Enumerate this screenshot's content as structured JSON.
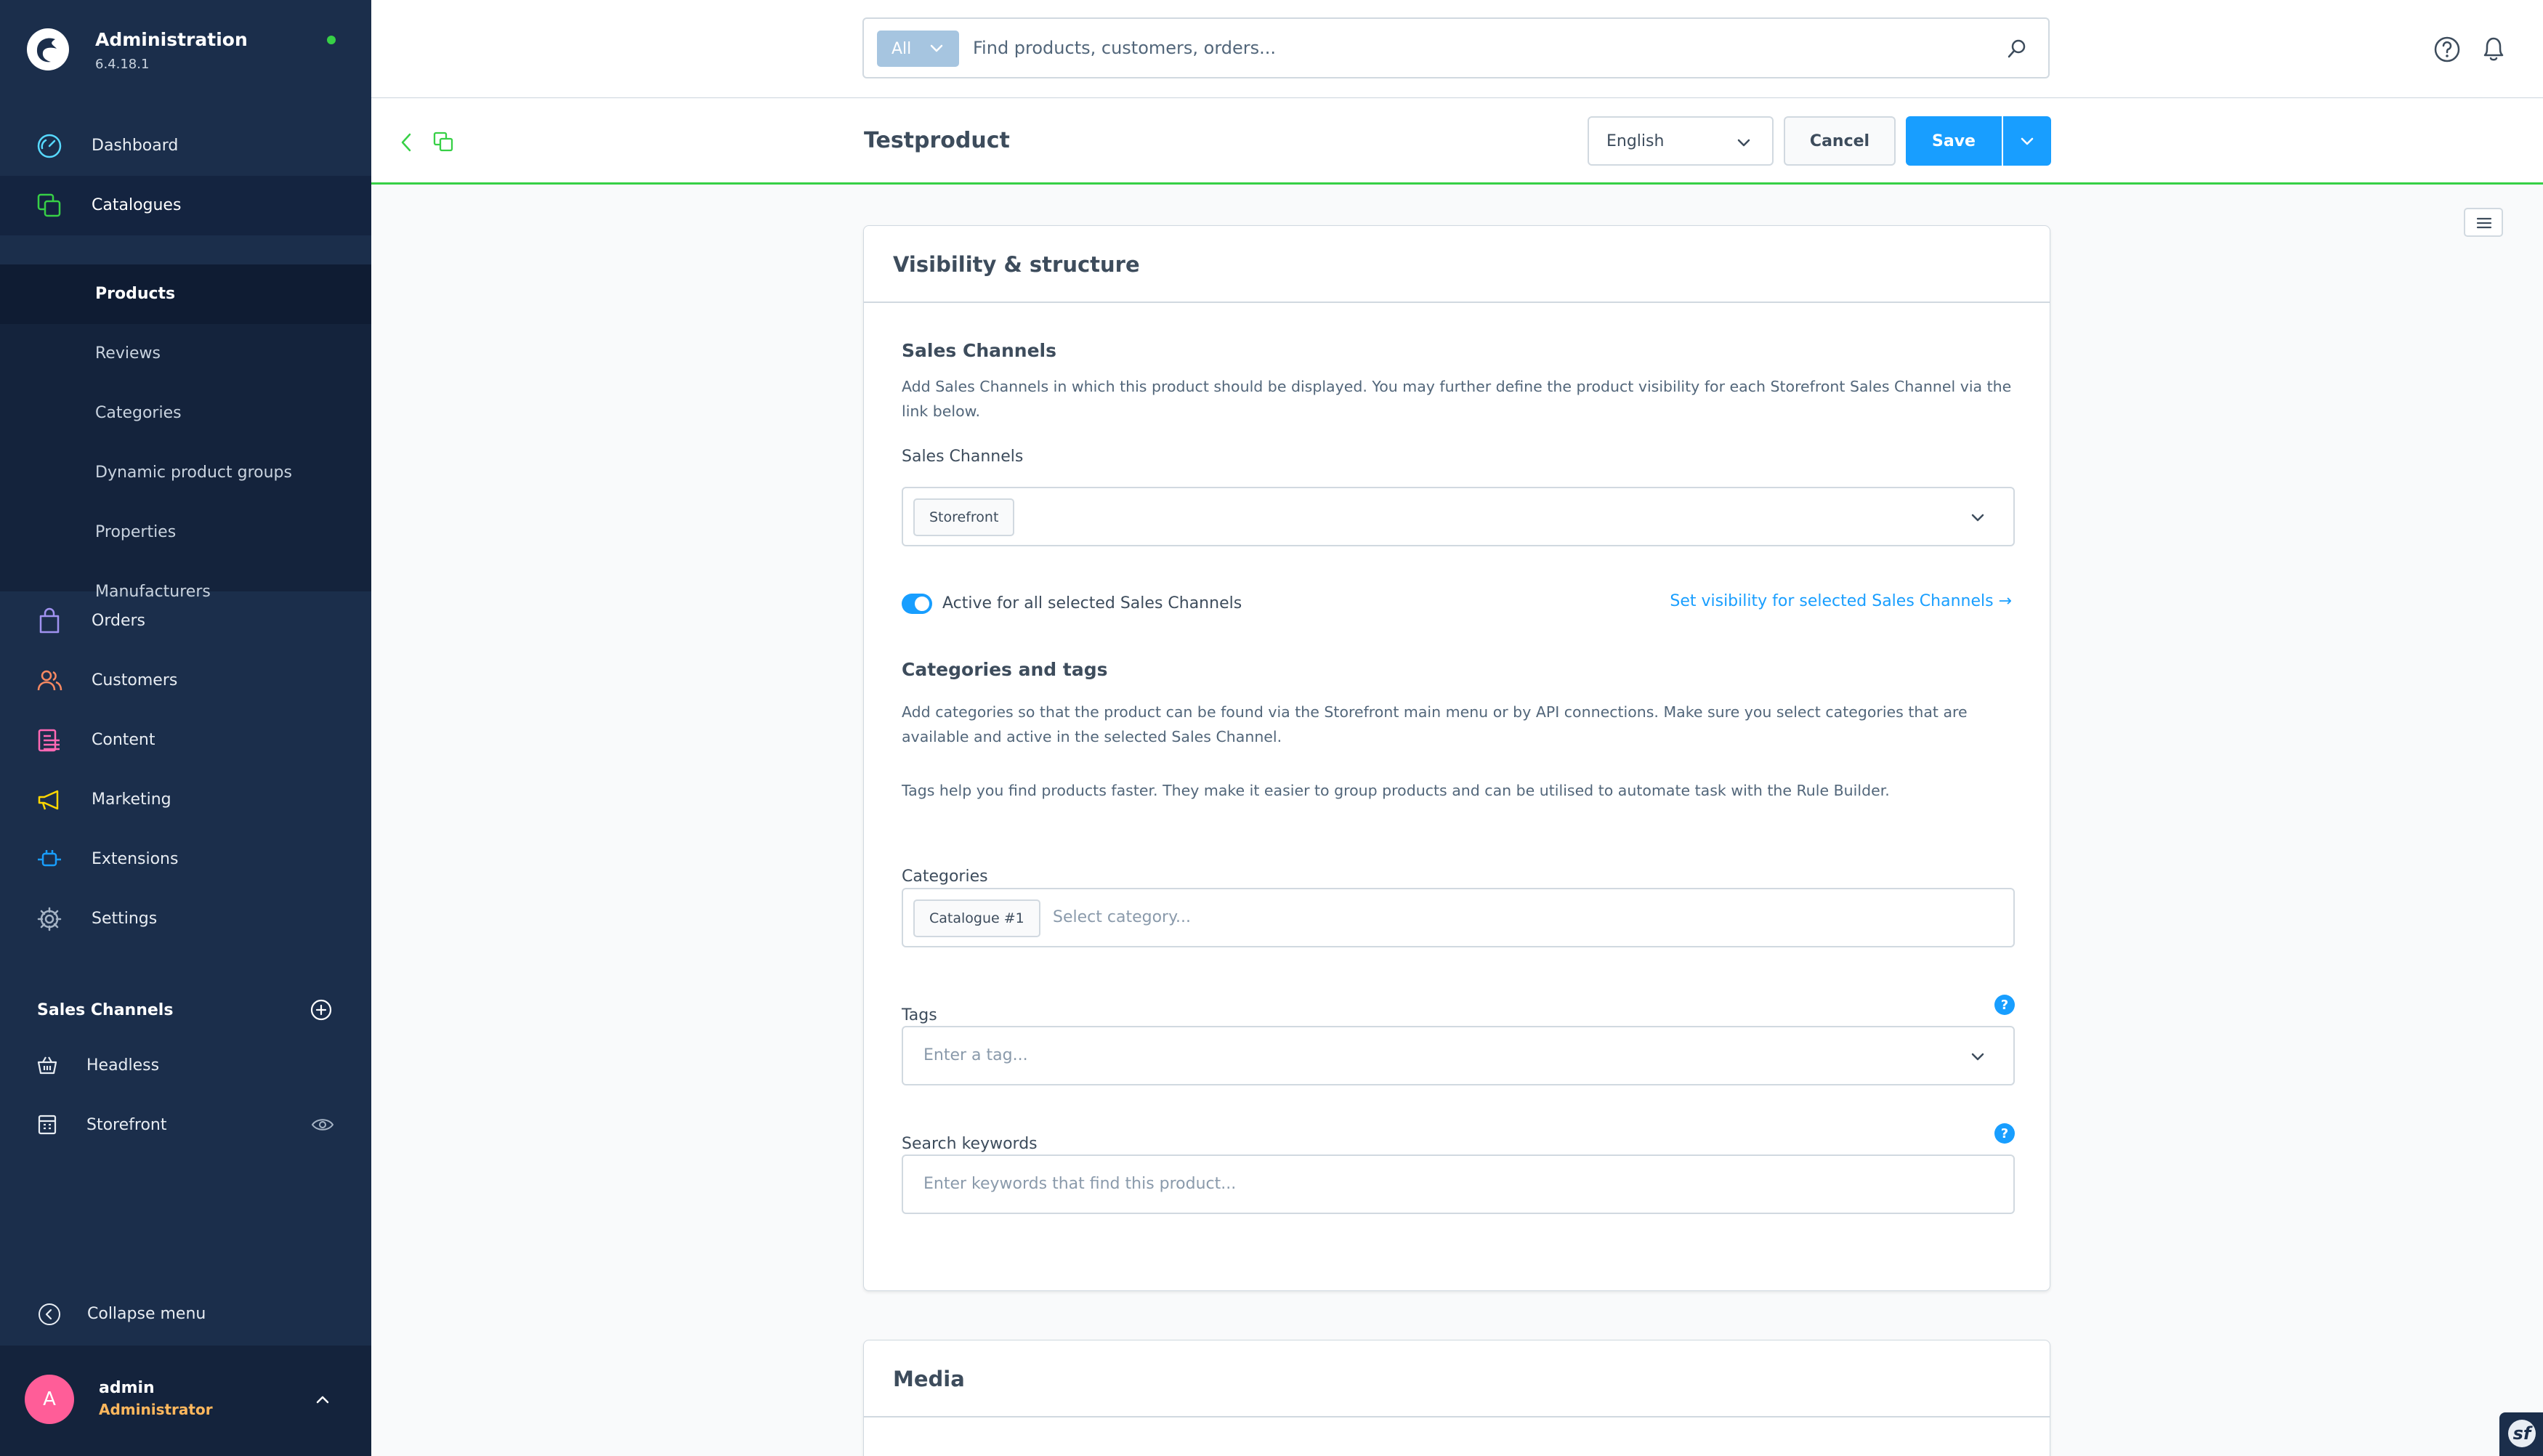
{
  "app": {
    "title": "Administration",
    "version": "6.4.18.1",
    "status_color": "#37d046"
  },
  "nav": {
    "dashboard": "Dashboard",
    "catalogues": "Catalogues",
    "catalogue_items": [
      "Products",
      "Reviews",
      "Categories",
      "Dynamic product groups",
      "Properties",
      "Manufacturers"
    ],
    "orders": "Orders",
    "customers": "Customers",
    "content": "Content",
    "marketing": "Marketing",
    "extensions": "Extensions",
    "settings": "Settings"
  },
  "sales_channels": {
    "header": "Sales Channels",
    "items": [
      "Headless",
      "Storefront"
    ]
  },
  "collapse_label": "Collapse menu",
  "user": {
    "initial": "A",
    "name": "admin",
    "role": "Administrator"
  },
  "search": {
    "type_label": "All",
    "placeholder": "Find products, customers, orders..."
  },
  "smartbar": {
    "title": "Testproduct",
    "language": "English",
    "cancel_label": "Cancel",
    "save_label": "Save"
  },
  "visibility_card": {
    "title": "Visibility & structure",
    "sales_channels_title": "Sales Channels",
    "sales_channels_help": "Add Sales Channels in which this product should be displayed. You may further define the product visibility for each Storefront Sales Channel via the link below.",
    "sales_channels_label": "Sales Channels",
    "sales_channels_selected": "Storefront",
    "active_toggle_label": "Active for all selected Sales Channels",
    "active_toggle_on": true,
    "visibility_link": "Set visibility for selected Sales Channels →",
    "categories_title": "Categories and tags",
    "categories_help": "Add categories so that the product can be found via the Storefront main menu or by API connections. Make sure you select categories that are available and active in the selected Sales Channel.",
    "tags_help": "Tags help you find products faster. They make it easier to group products and can be utilised to automate task with the Rule Builder.",
    "categories_label": "Categories",
    "categories_selected": "Catalogue #1",
    "categories_placeholder": "Select category...",
    "tags_label": "Tags",
    "tags_placeholder": "Enter a tag...",
    "keywords_label": "Search keywords",
    "keywords_placeholder": "Enter keywords that find this product...",
    "help_icon_text": "?"
  },
  "media_card": {
    "title": "Media"
  },
  "colors": {
    "sidebar_bg": "#1b2e4b",
    "primary": "#189eff",
    "accent_green": "#37d046",
    "user_role": "#ffb75d",
    "avatar": "#ff5d98"
  }
}
